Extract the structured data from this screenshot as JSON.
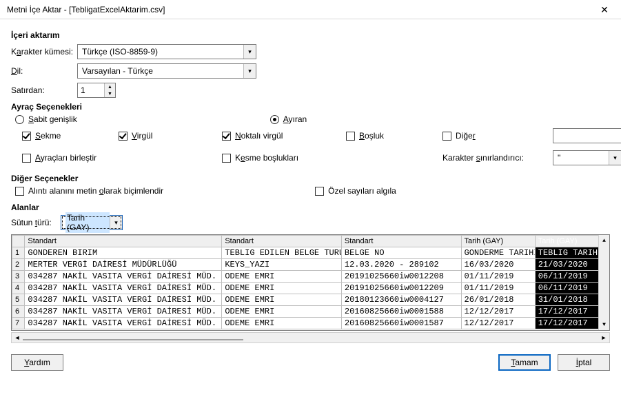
{
  "window": {
    "title": "Metni İçe Aktar - [TebligatExcelAktarim.csv]"
  },
  "import": {
    "heading": "İçeri aktarım",
    "charset_label": "Karakter kümesi:",
    "charset_value": "Türkçe (ISO-8859-9)",
    "lang_label": "Dil:",
    "lang_value": "Varsayılan - Türkçe",
    "fromrow_label": "Satırdan:",
    "fromrow_value": "1"
  },
  "sep": {
    "heading": "Ayraç Seçenekleri",
    "fixed": "Sabit genişlik",
    "delimited": "Ayıran",
    "tab": "Sekme",
    "comma": "Virgül",
    "semicolon": "Noktalı virgül",
    "space": "Boşluk",
    "other": "Diğer",
    "merge": "Ayraçları birleştir",
    "trim": "Kesme boşlukları",
    "textdelim_label": "Karakter sınırlandırıcı:",
    "textdelim_value": "\""
  },
  "otheropts": {
    "heading": "Diğer Seçenekler",
    "quoted": "Alıntı alanını metin olarak biçimlendir",
    "detect": "Özel sayıları algıla"
  },
  "fields": {
    "heading": "Alanlar",
    "coltype_label": "Sütun türü:",
    "coltype_value": "Tarih (GAY)"
  },
  "preview": {
    "headers": [
      "Standart",
      "Standart",
      "Standart",
      "Tarih (GAY)",
      "Tarih (GAY)"
    ],
    "rows": [
      [
        "GONDEREN BIRIM",
        "TEBLIG EDILEN BELGE TURU",
        "BELGE NO",
        "GONDERME TARIHI",
        "TEBLIG TARIHI"
      ],
      [
        "MERTER VERGİ DAİRESİ MÜDÜRLÜĞÜ",
        "KEYS_YAZI",
        "12.03.2020 - 289102",
        "16/03/2020",
        "21/03/2020"
      ],
      [
        "034287 NAKİL VASITA VERGİ DAİRESİ MÜD.",
        "ODEME EMRI",
        "20191025660iw0012208",
        "01/11/2019",
        "06/11/2019"
      ],
      [
        "034287 NAKİL VASITA VERGİ DAİRESİ MÜD.",
        "ODEME EMRI",
        "20191025660iw0012209",
        "01/11/2019",
        "06/11/2019"
      ],
      [
        "034287 NAKİL VASITA VERGİ DAİRESİ MÜD.",
        "ODEME EMRI",
        "20180123660iw0004127",
        "26/01/2018",
        "31/01/2018"
      ],
      [
        "034287 NAKİL VASITA VERGİ DAİRESİ MÜD.",
        "ODEME EMRI",
        "20160825660iw0001588",
        "12/12/2017",
        "17/12/2017"
      ],
      [
        "034287 NAKİL VASITA VERGİ DAİRESİ MÜD.",
        "ODEME EMRI",
        "20160825660iw0001587",
        "12/12/2017",
        "17/12/2017"
      ]
    ]
  },
  "buttons": {
    "help": "Yardım",
    "ok": "Tamam",
    "cancel": "İptal"
  }
}
